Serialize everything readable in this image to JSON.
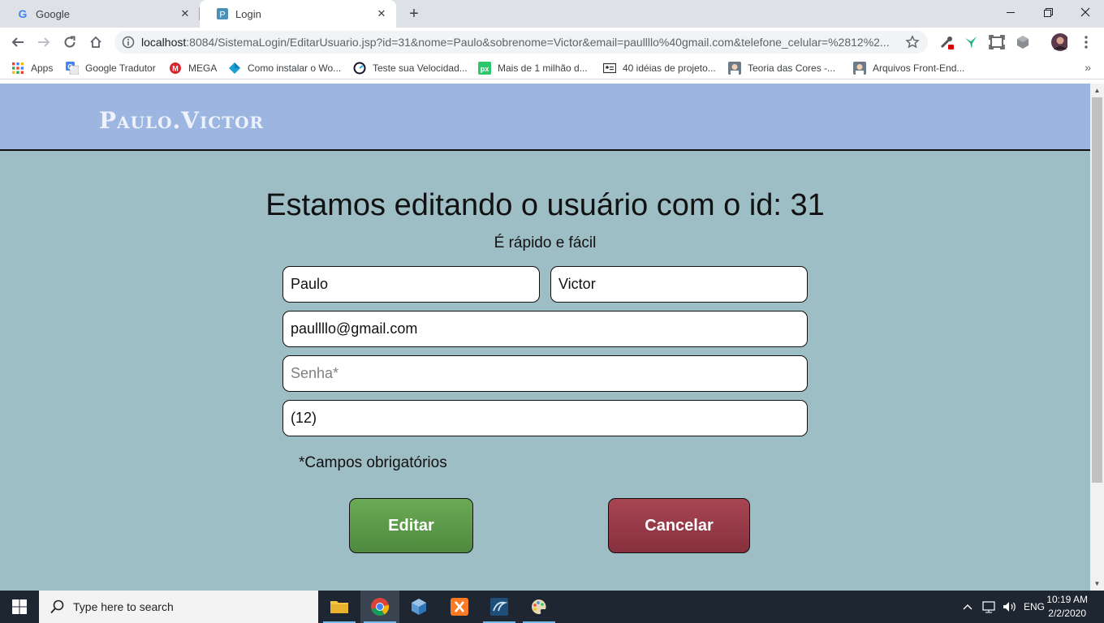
{
  "browser": {
    "tabs": [
      {
        "title": "Google"
      },
      {
        "title": "Login"
      }
    ],
    "url_host": "localhost",
    "url_rest": ":8084/SistemaLogin/EditarUsuario.jsp?id=31&nome=Paulo&sobrenome=Victor&email=paullllo%40gmail.com&telefone_celular=%2812%2...",
    "bookmarks": [
      {
        "label": "Apps"
      },
      {
        "label": "Google Tradutor"
      },
      {
        "label": "MEGA"
      },
      {
        "label": "Como instalar o Wo..."
      },
      {
        "label": "Teste sua Velocidad..."
      },
      {
        "label": "Mais de 1 milhão d..."
      },
      {
        "label": "40 idéias de projeto..."
      },
      {
        "label": "Teoria das Cores -..."
      },
      {
        "label": "Arquivos Front-End..."
      }
    ]
  },
  "page": {
    "logo": "Paulo.Victor",
    "title": "Estamos editando o usuário com o id: 31",
    "subtitle": "É rápido e fácil",
    "form": {
      "first_name": "Paulo",
      "last_name": "Victor",
      "email": "paullllo@gmail.com",
      "password_placeholder": "Senha*",
      "phone": "(12)"
    },
    "required_note": "*Campos obrigatórios",
    "edit_label": "Editar",
    "cancel_label": "Cancelar",
    "colors": {
      "header_bg": "#9cb5e1",
      "page_bg": "#9ebec5",
      "edit_button": "#5e9e4b",
      "cancel_button": "#9b3b49"
    }
  },
  "taskbar": {
    "search_placeholder": "Type here to search",
    "language": "ENG",
    "time": "10:19 AM",
    "date": "2/2/2020"
  }
}
